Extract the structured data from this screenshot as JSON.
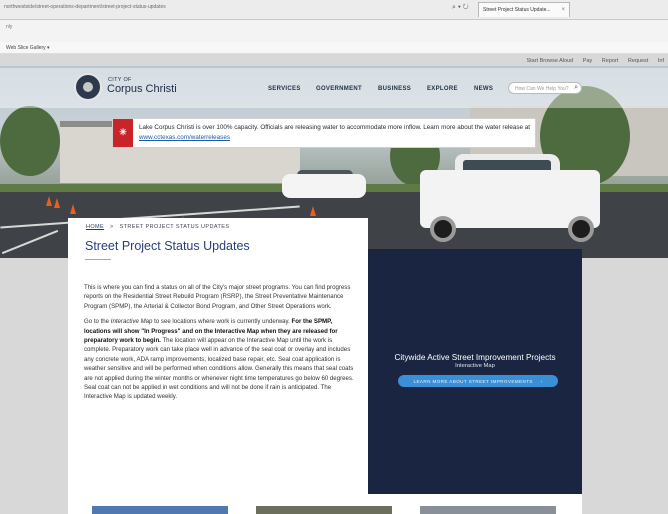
{
  "browser": {
    "url": "northwestside/street-operations-department/street-project-status-updates",
    "tab_title": "Street Project Status Update...",
    "tab_close": "×",
    "history_hint": "nly",
    "favorites": "Web Slice Gallery ▾"
  },
  "utility_links": [
    "Start Browse Aloud",
    "Pay",
    "Report",
    "Request",
    "Inf"
  ],
  "header": {
    "city_of": "CITY OF",
    "city_name": "Corpus Christi",
    "nav": [
      "SERVICES",
      "GOVERNMENT",
      "BUSINESS",
      "EXPLORE",
      "NEWS"
    ],
    "search_placeholder": "How Can We Help You?"
  },
  "alert": {
    "text": "Lake Corpus Christi is over 100% capacity. Officials are releasing water to accommodate more inflow. Learn more about the water release at ",
    "link": "www.cctexas.com/waterreleases"
  },
  "breadcrumb": {
    "home": "HOME",
    "separator": ">",
    "current": "STREET PROJECT STATUS UPDATES"
  },
  "page_title": "Street Project Status Updates",
  "body": {
    "p1": "This is where you can find a status on all of the City's major street programs. You can find progress reports on the Residential Street Rebuild Program (RSRP), the Street Preventative Maintenance Program (SPMP), the Arterial & Collector Bond Program, and Other Street Operations work.",
    "p2_a": "Go to the ",
    "p2_map": "Interactive Map",
    "p2_b": " to see locations where work is currently underway. ",
    "p2_bold": "For the SPMP, locations will show \"In Progress\" and on the Interactive Map when they are released for preparatory work to begin.",
    "p2_c": " The location will appear on the Interactive Map until the work is complete. Preparatory work can take place well in advance of the seal coat or overlay and includes any concrete work, ADA ramp improvements, localized base repair, etc. Seal coat application is weather sensitive and will be performed when conditions allow. Generally this means that seal coats are not applied during the winter months or whenever night time temperatures go below 60 degrees. Seal coat can not be applied in wet conditions and will not be done if rain is anticipated. The Interactive Map is updated weekly."
  },
  "panel": {
    "title": "Citywide Active Street Improvement Projects",
    "subtitle": "Interactive Map",
    "button": "LEARN MORE ABOUT STREET IMPROVEMENTS",
    "button_arrow": "›"
  },
  "icons": {
    "search": "search-icon",
    "alert": "alert-icon"
  },
  "colors": {
    "navy": "#1a2542",
    "accent_blue": "#3a8fd6",
    "alert_red": "#c8242a",
    "title_blue": "#2a3f77"
  }
}
